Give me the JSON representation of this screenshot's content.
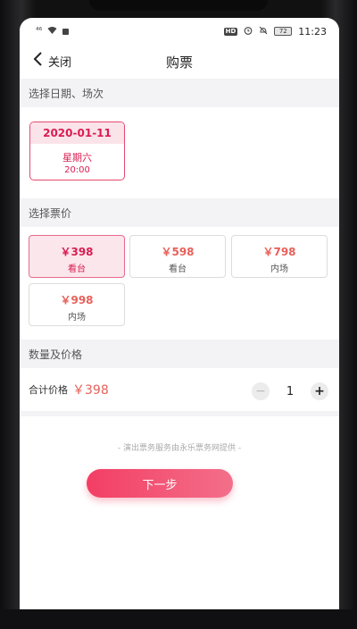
{
  "status_bar": {
    "left_icons": [
      "signal-icon",
      "wifi-icon",
      "notification-icon"
    ],
    "signal_text": "⁴⁶",
    "hd_label": "HD",
    "battery_level": "72",
    "time": "11:23"
  },
  "header": {
    "back_icon": "chevron-left-icon",
    "back_label": "关闭",
    "title": "购票"
  },
  "date_section": {
    "title": "选择日期、场次",
    "cards": [
      {
        "date": "2020-01-11",
        "weekday": "星期六",
        "time": "20:00",
        "selected": true
      }
    ]
  },
  "price_section": {
    "title": "选择票价",
    "options": [
      {
        "price": "￥398",
        "zone": "看台",
        "selected": true
      },
      {
        "price": "￥598",
        "zone": "看台",
        "selected": false
      },
      {
        "price": "￥798",
        "zone": "内场",
        "selected": false
      },
      {
        "price": "￥998",
        "zone": "内场",
        "selected": false
      }
    ]
  },
  "quantity_section": {
    "title": "数量及价格",
    "total_label": "合计价格",
    "total_price": "￥398",
    "minus_symbol": "−",
    "plus_symbol": "+",
    "quantity": "1"
  },
  "provider_note": "- 演出票务服务由永乐票务网提供 -",
  "next_button": "下一步",
  "colors": {
    "accent": "#d91d50",
    "price": "#e7605a",
    "button_start": "#f33e64",
    "button_end": "#f36f8a"
  }
}
